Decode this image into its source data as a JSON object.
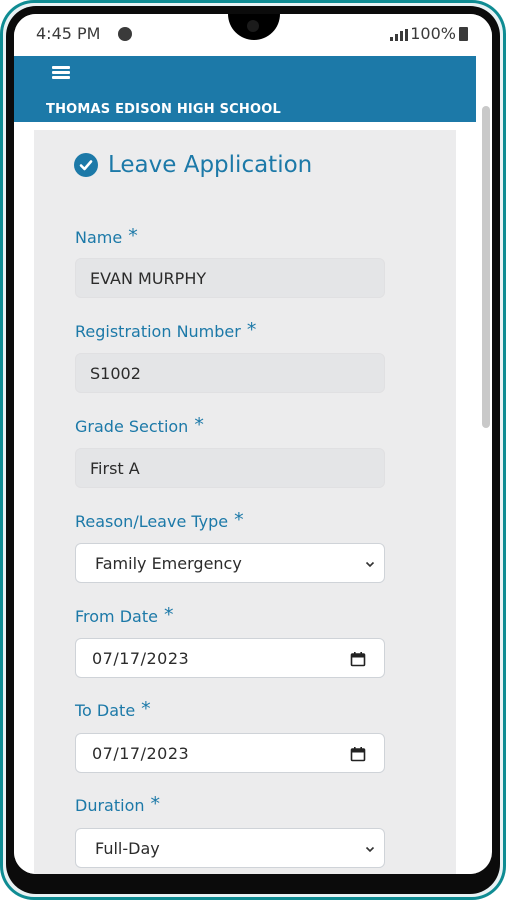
{
  "status": {
    "time": "4:45 PM",
    "battery": "100%"
  },
  "app": {
    "school_name": "THOMAS EDISON HIGH SCHOOL"
  },
  "form": {
    "title": "Leave Application",
    "name": {
      "label": "Name",
      "value": "EVAN MURPHY"
    },
    "registration": {
      "label": "Registration Number",
      "value": "S1002"
    },
    "grade": {
      "label": "Grade Section",
      "value": "First A"
    },
    "reason": {
      "label": "Reason/Leave Type",
      "value": "Family Emergency"
    },
    "from_date": {
      "label": "From Date",
      "value": "07/17/2023"
    },
    "to_date": {
      "label": "To Date",
      "value": "07/17/2023"
    },
    "duration": {
      "label": "Duration",
      "value": "Full-Day"
    },
    "required_mark": "*"
  },
  "colors": {
    "brand": "#1c79a8",
    "card_bg": "#ececed",
    "field_bg": "#e4e5e7"
  },
  "icons": [
    "menu-icon",
    "check-circle-icon",
    "chevron-down-icon",
    "calendar-icon",
    "message-icon",
    "signal-icon",
    "battery-icon"
  ]
}
